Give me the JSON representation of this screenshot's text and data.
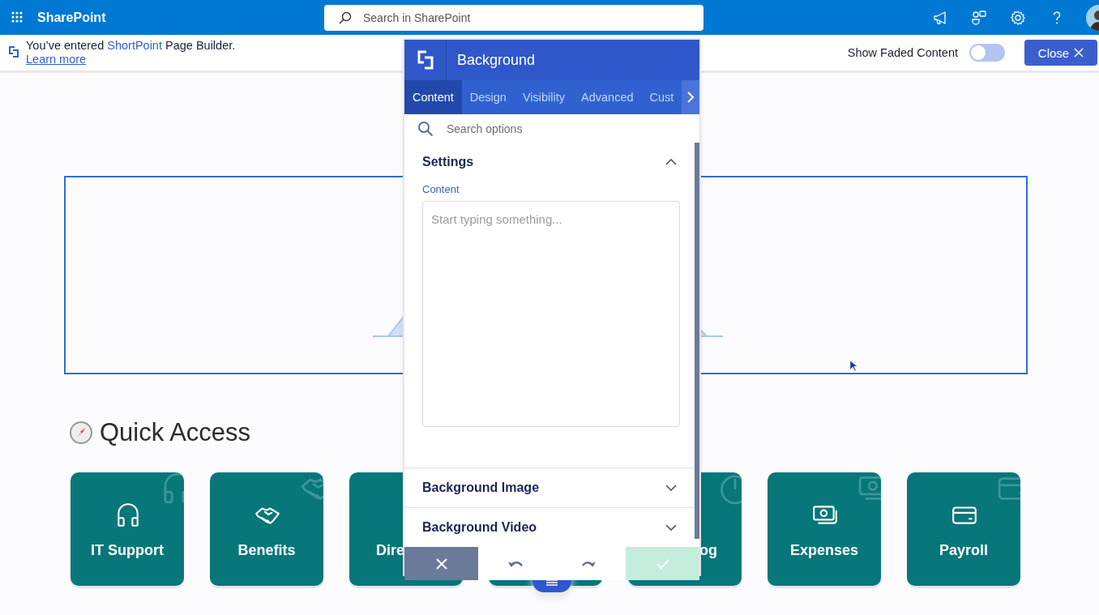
{
  "app_bar": {
    "title": "SharePoint",
    "search": {
      "placeholder": "Search in SharePoint"
    }
  },
  "notice": {
    "prefix": "You’ve entered",
    "brand": "ShortPoint",
    "suffix": "Page Builder.",
    "link": "Learn more"
  },
  "faded_toggle": {
    "label": "Show Faded Content",
    "on": false
  },
  "close_button": "Close",
  "section": {
    "title": "Quick Access",
    "tiles": [
      {
        "kind": "tile",
        "label": "IT Support"
      },
      {
        "kind": "tile",
        "label": "Benefits"
      },
      {
        "kind": "tile",
        "label": "Dire"
      },
      {
        "kind": "tile"
      },
      {
        "kind": "tile",
        "label": "og"
      },
      {
        "kind": "tile",
        "label": "Expenses"
      },
      {
        "kind": "tile",
        "label": "Payroll"
      }
    ]
  },
  "panel": {
    "title": "Background",
    "tabs": [
      {
        "label": "Content",
        "selected": true
      },
      {
        "label": "Design",
        "selected": false
      },
      {
        "label": "Visibility",
        "selected": false
      },
      {
        "label": "Advanced",
        "selected": false
      },
      {
        "label": "Cust",
        "selected": false
      }
    ],
    "search": {
      "placeholder": "Search options"
    },
    "groups": [
      {
        "title": "Settings",
        "expanded": true,
        "field": {
          "label": "Content",
          "placeholder": "Start typing something..."
        }
      },
      {
        "title": "Background Image",
        "expanded": false
      },
      {
        "title": "Background Video",
        "expanded": false
      }
    ]
  }
}
